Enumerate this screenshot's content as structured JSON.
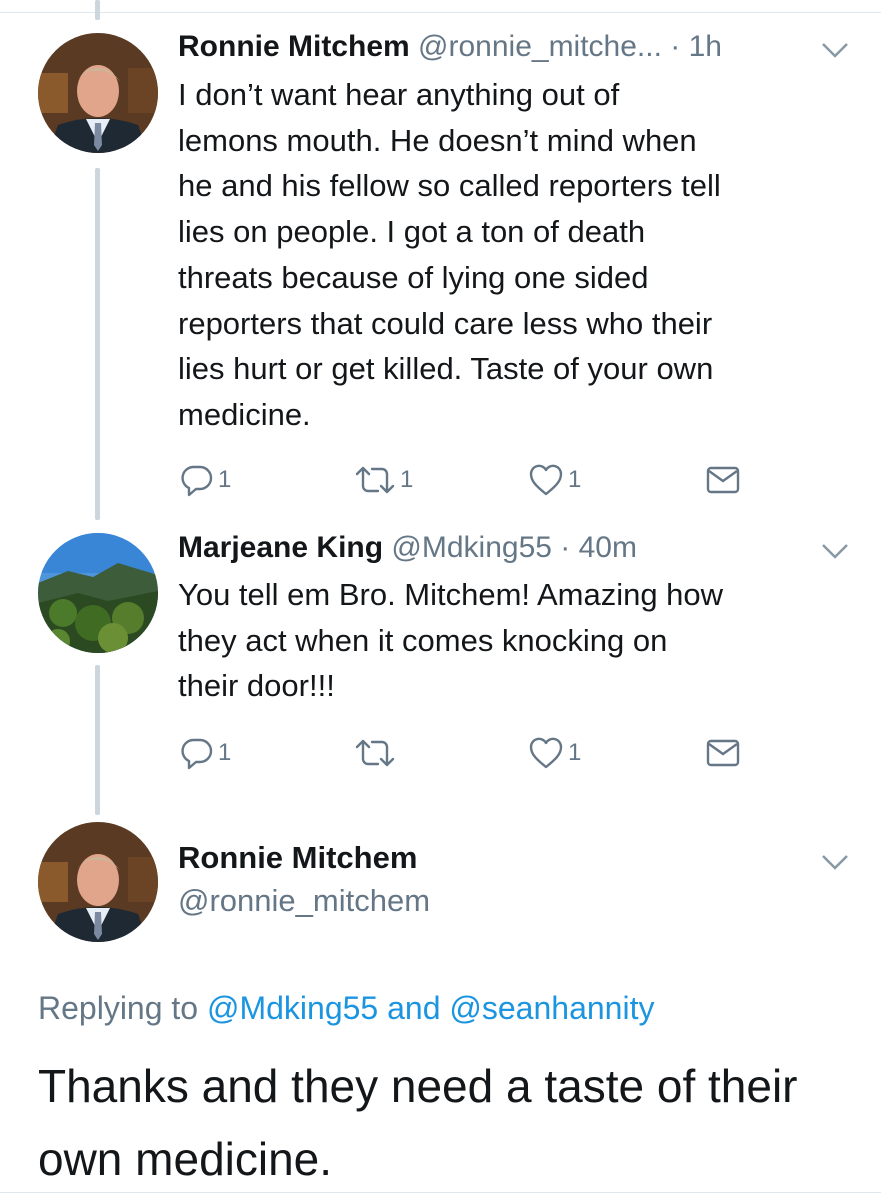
{
  "tweet1": {
    "name": "Ronnie Mitchem",
    "handle": "@ronnie_mitche...",
    "dot": " · ",
    "time": "1h",
    "lines": [
      "I don’t want hear anything out of",
      "lemons mouth. He doesn’t mind when",
      "he and his fellow so called reporters tell",
      "lies on people. I got a ton of death",
      "threats because of lying one sided",
      "reporters that could care less who their",
      "lies hurt or get killed. Taste of your own",
      "medicine."
    ],
    "actions": {
      "reply_count": "1",
      "retweet_count": "1",
      "like_count": "1"
    }
  },
  "tweet2": {
    "name": "Marjeane King",
    "handle": "@Mdking55",
    "dot": " · ",
    "time": "40m",
    "lines": [
      "You tell em Bro. Mitchem! Amazing how",
      "they act when it comes knocking on",
      "their door!!!"
    ],
    "actions": {
      "reply_count": "1",
      "retweet_count": "",
      "like_count": "1"
    }
  },
  "main_tweet": {
    "name": "Ronnie Mitchem",
    "handle": "@ronnie_mitchem",
    "replying_prefix": "Replying to ",
    "mention1": "@Mdking55",
    "and": " and ",
    "mention2": "@seanhannity",
    "lines": [
      "Thanks and they need a taste of their",
      "own medicine."
    ]
  },
  "icons": {
    "reply": "reply-icon",
    "retweet": "retweet-icon",
    "like": "heart-icon",
    "dm": "envelope-icon",
    "more": "chevron-down-icon"
  },
  "colors": {
    "link": "#1b95e0",
    "secondary": "#657786",
    "line": "#ccd6dd"
  }
}
